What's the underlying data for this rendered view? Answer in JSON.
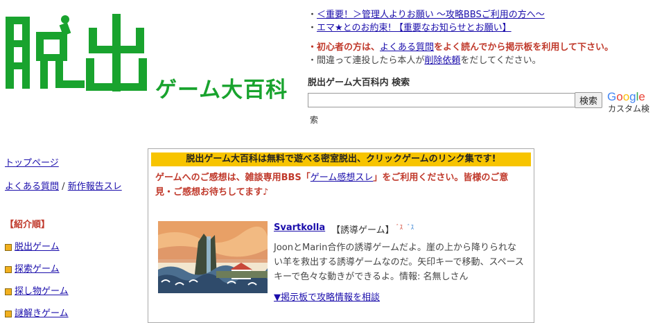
{
  "logo": {
    "main": "脱出",
    "sub": "ゲーム大百科"
  },
  "notices": {
    "n1": "＜重要！＞管理人よりお願い ～攻略BBSご利用の方へ～",
    "n2": "エマ★とのお約束! 【重要なお知らせとお願い】",
    "n3_pre": "初心者の方は、",
    "n3_link": "よくある質問",
    "n3_post": "をよく読んでから掲示板を利用して下さい。",
    "n4_pre": "間違って連投したら本人が",
    "n4_link": "削除依頼",
    "n4_post": "をだしてください。",
    "bullet": "・"
  },
  "search": {
    "title": "脱出ゲーム大百科内 検索",
    "value": "",
    "button": "検索",
    "google": "Google",
    "custom": "カスタム検",
    "custom2": "索"
  },
  "sidebar": {
    "top": "トップページ",
    "faq": "よくある質問",
    "sep": "/",
    "newreport": "新作報告スレ",
    "section": "【紹介順】",
    "cat1": "脱出ゲーム",
    "cat2": "探索ゲーム",
    "cat3": "探し物ゲーム",
    "cat4": "謎解きゲーム"
  },
  "main": {
    "banner": "脱出ゲーム大百科は無料で遊べる密室脱出、クリックゲームのリンク集です!",
    "fb_pre": "ゲームへのご感想は、雑談専用BBS「",
    "fb_link": "ゲーム感想スレ",
    "fb_post": "」をご利用ください。皆様のご意見・ご感想お待ちしてます♪",
    "game": {
      "title": "Svartkolla",
      "genre": "【誘導ゲーム】",
      "icons": "ﾞｽﾞｽ",
      "desc": "JoonとMarin合作の誘導ゲームだよ。崖の上から降りられない羊を救出する誘導ゲームなのだ。矢印キーで移動、スペースキーで色々な動きができるよ。情報: 名無しさん",
      "link": "▼掲示板で攻略情報を相談"
    }
  },
  "colors": {
    "logo_green": "#19a32e",
    "banner_yellow": "#f7c400",
    "warn_red": "#c0392b",
    "link_blue": "#1a0dab"
  }
}
